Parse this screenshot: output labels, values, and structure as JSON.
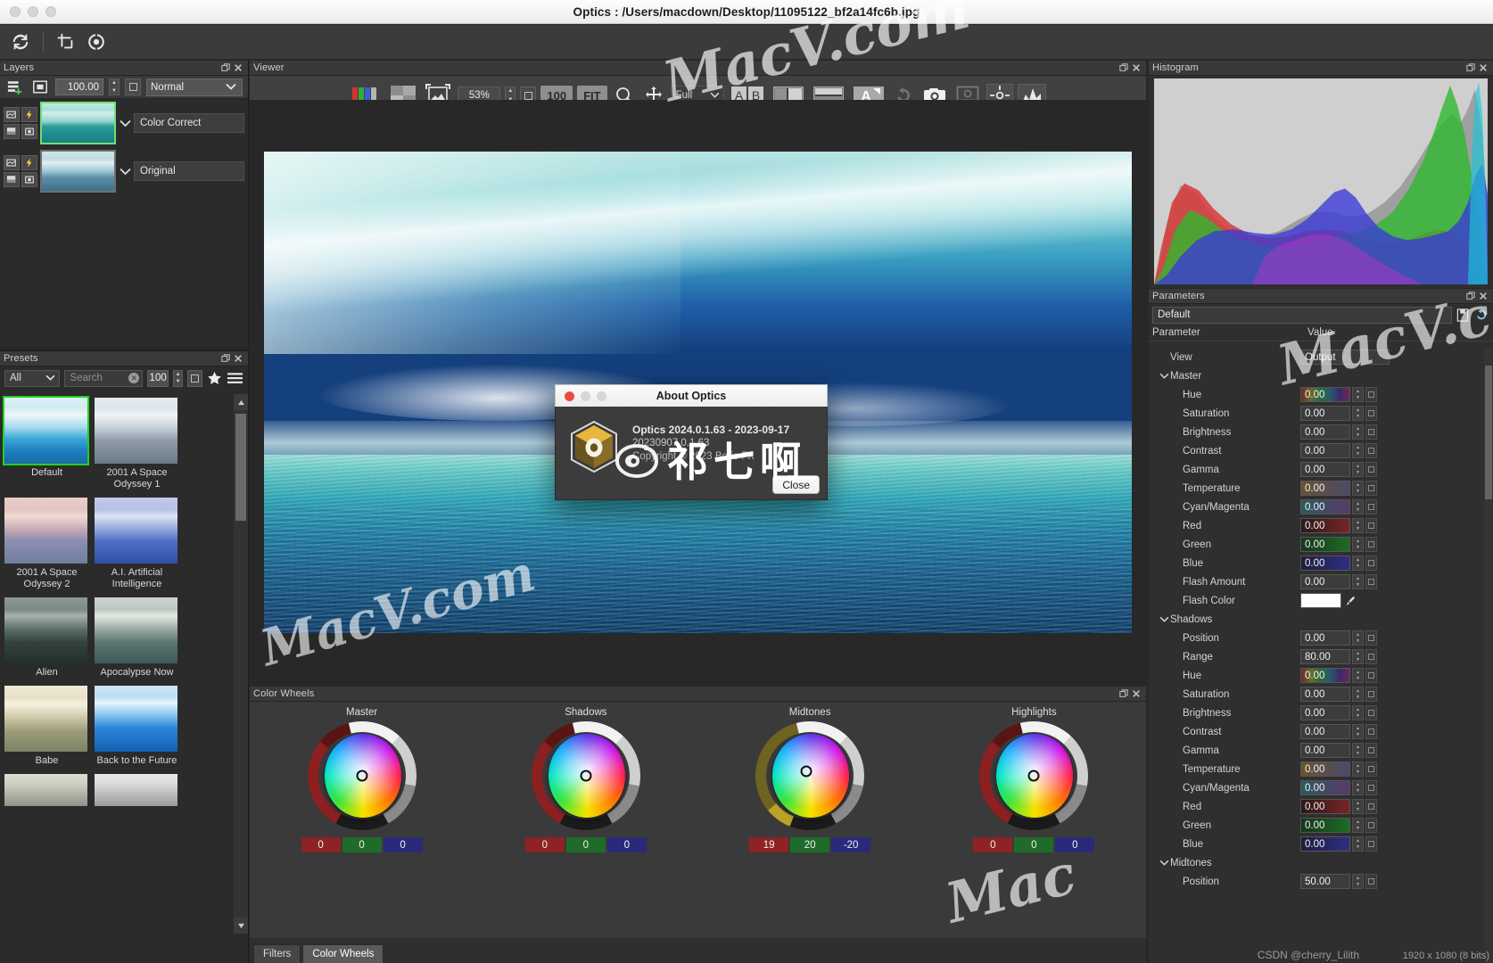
{
  "window": {
    "title": "Optics : /Users/macdown/Desktop/11095122_bf2a14fc6b.jpg"
  },
  "toolbar": {
    "buttons": [
      {
        "name": "refresh-icon",
        "label": "Refresh"
      },
      {
        "name": "crop-icon",
        "label": "Crop"
      },
      {
        "name": "color-target-icon",
        "label": "Color Target"
      }
    ]
  },
  "layers": {
    "title": "Layers",
    "opacity": "100.00",
    "blend_mode": "Normal",
    "items": [
      {
        "name": "Color Correct",
        "selected": true
      },
      {
        "name": "Original",
        "selected": false
      }
    ]
  },
  "presets": {
    "title": "Presets",
    "filter": "All",
    "search_placeholder": "Search",
    "size": "100",
    "items": [
      {
        "label": "Default",
        "selected": true
      },
      {
        "label": "2001 A Space Odyssey 1",
        "selected": false
      },
      {
        "label": "2001 A Space Odyssey 2",
        "selected": false
      },
      {
        "label": "A.I. Artificial Intelligence",
        "selected": false
      },
      {
        "label": "Alien",
        "selected": false
      },
      {
        "label": "Apocalypse Now",
        "selected": false
      },
      {
        "label": "Babe",
        "selected": false
      },
      {
        "label": "Back to the Future",
        "selected": false
      }
    ]
  },
  "viewer": {
    "title": "Viewer",
    "zoom": "53%",
    "zoom_100": "100",
    "zoom_fit": "FIT",
    "view_mode": "Full",
    "buttons": [
      {
        "name": "rgb-channels-icon"
      },
      {
        "name": "checkerboard-icon"
      },
      {
        "name": "fit-image-icon"
      },
      {
        "name": "zoom-icon"
      },
      {
        "name": "pan-icon"
      },
      {
        "name": "ab-compare-icon"
      },
      {
        "name": "split-vertical-icon"
      },
      {
        "name": "split-horizontal-icon"
      },
      {
        "name": "text-overlay-icon"
      },
      {
        "name": "reset-icon"
      },
      {
        "name": "snapshot-icon"
      },
      {
        "name": "monitor-icon"
      },
      {
        "name": "center-icon"
      },
      {
        "name": "histogram-toggle-icon"
      }
    ]
  },
  "histogram": {
    "title": "Histogram"
  },
  "color_wheels": {
    "title": "Color Wheels",
    "wheels": [
      {
        "label": "Master",
        "values": [
          "0",
          "0",
          "0"
        ]
      },
      {
        "label": "Shadows",
        "values": [
          "0",
          "0",
          "0"
        ]
      },
      {
        "label": "Midtones",
        "values": [
          "19",
          "20",
          "-20"
        ]
      },
      {
        "label": "Highlights",
        "values": [
          "0",
          "0",
          "0"
        ]
      }
    ],
    "tabs": [
      {
        "label": "Filters",
        "active": false
      },
      {
        "label": "Color Wheels",
        "active": true
      }
    ]
  },
  "parameters": {
    "title": "Parameters",
    "preset": "Default",
    "columns": {
      "parameter": "Parameter",
      "value": "Value"
    },
    "rows": [
      {
        "label": "View",
        "indent": "view",
        "value": "Output",
        "kind": "select"
      },
      {
        "label": "Master",
        "indent": "group",
        "expanded": true,
        "kind": "group"
      },
      {
        "label": "Hue",
        "indent": "child",
        "value": "0.00",
        "kind": "hue"
      },
      {
        "label": "Saturation",
        "indent": "child",
        "value": "0.00",
        "kind": "plain"
      },
      {
        "label": "Brightness",
        "indent": "child",
        "value": "0.00",
        "kind": "plain"
      },
      {
        "label": "Contrast",
        "indent": "child",
        "value": "0.00",
        "kind": "plain"
      },
      {
        "label": "Gamma",
        "indent": "child",
        "value": "0.00",
        "kind": "plain"
      },
      {
        "label": "Temperature",
        "indent": "child",
        "value": "0.00",
        "kind": "temp"
      },
      {
        "label": "Cyan/Magenta",
        "indent": "child",
        "value": "0.00",
        "kind": "cyanmag"
      },
      {
        "label": "Red",
        "indent": "child",
        "value": "0.00",
        "kind": "red"
      },
      {
        "label": "Green",
        "indent": "child",
        "value": "0.00",
        "kind": "green"
      },
      {
        "label": "Blue",
        "indent": "child",
        "value": "0.00",
        "kind": "blue"
      },
      {
        "label": "Flash Amount",
        "indent": "child",
        "value": "0.00",
        "kind": "plain"
      },
      {
        "label": "Flash Color",
        "indent": "child",
        "value": "",
        "kind": "swatch"
      },
      {
        "label": "Shadows",
        "indent": "group",
        "expanded": true,
        "kind": "group"
      },
      {
        "label": "Position",
        "indent": "child",
        "value": "0.00",
        "kind": "plain"
      },
      {
        "label": "Range",
        "indent": "child",
        "value": "80.00",
        "kind": "plain"
      },
      {
        "label": "Hue",
        "indent": "child",
        "value": "0.00",
        "kind": "hue"
      },
      {
        "label": "Saturation",
        "indent": "child",
        "value": "0.00",
        "kind": "plain"
      },
      {
        "label": "Brightness",
        "indent": "child",
        "value": "0.00",
        "kind": "plain"
      },
      {
        "label": "Contrast",
        "indent": "child",
        "value": "0.00",
        "kind": "plain"
      },
      {
        "label": "Gamma",
        "indent": "child",
        "value": "0.00",
        "kind": "plain"
      },
      {
        "label": "Temperature",
        "indent": "child",
        "value": "0.00",
        "kind": "temp"
      },
      {
        "label": "Cyan/Magenta",
        "indent": "child",
        "value": "0.00",
        "kind": "cyanmag"
      },
      {
        "label": "Red",
        "indent": "child",
        "value": "0.00",
        "kind": "red"
      },
      {
        "label": "Green",
        "indent": "child",
        "value": "0.00",
        "kind": "green"
      },
      {
        "label": "Blue",
        "indent": "child",
        "value": "0.00",
        "kind": "blue"
      },
      {
        "label": "Midtones",
        "indent": "group",
        "expanded": true,
        "kind": "group"
      },
      {
        "label": "Position",
        "indent": "child",
        "value": "50.00",
        "kind": "plain"
      }
    ]
  },
  "about_dialog": {
    "title": "About Optics",
    "version": "Optics 2024.0.1.63 - 2023-09-17",
    "build": "20230907.0.1.63",
    "copyright": "Copyright © 2023 Boris FX",
    "close_label": "Close"
  },
  "status": {
    "credit": "CSDN @cherry_Lilith",
    "resolution": "1920 x 1080 (8 bits)"
  },
  "watermarks": {
    "top": "MacV.com",
    "left": "MacV.com",
    "right": "MacV.co",
    "bottom": "Mac",
    "weibo": "祁七啊"
  },
  "colors": {
    "accent_green": "#21d221",
    "panel_bg": "#2f2f2f",
    "toolbar_bg": "#3b3b3b"
  }
}
